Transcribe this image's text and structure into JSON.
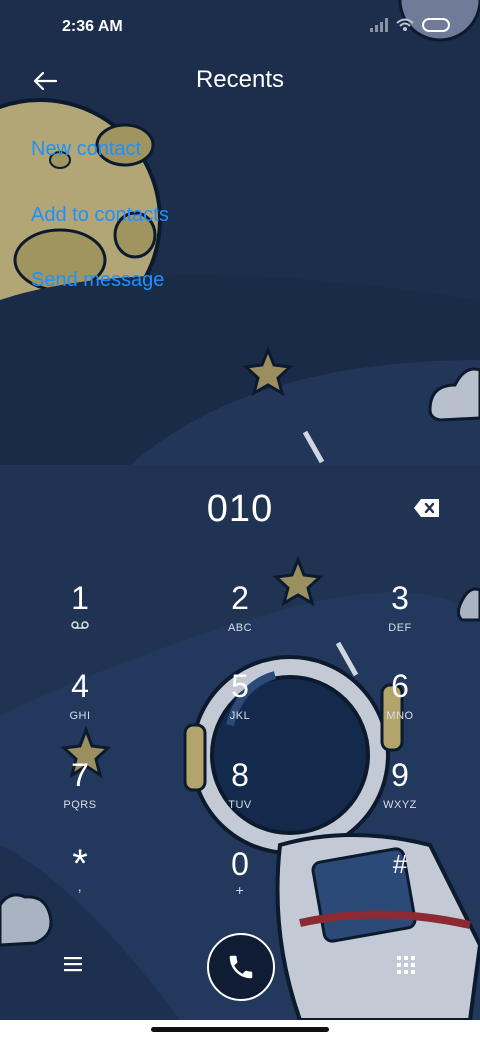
{
  "status_bar": {
    "time": "2:36 AM"
  },
  "header": {
    "title": "Recents"
  },
  "menu": [
    {
      "label": "New contact"
    },
    {
      "label": "Add to contacts"
    },
    {
      "label": "Send message"
    }
  ],
  "dialer": {
    "number": "010"
  },
  "keypad": [
    {
      "digit": "1",
      "letters": ""
    },
    {
      "digit": "2",
      "letters": "ABC"
    },
    {
      "digit": "3",
      "letters": "DEF"
    },
    {
      "digit": "4",
      "letters": "GHI"
    },
    {
      "digit": "5",
      "letters": "JKL"
    },
    {
      "digit": "6",
      "letters": "MNO"
    },
    {
      "digit": "7",
      "letters": "PQRS"
    },
    {
      "digit": "8",
      "letters": "TUV"
    },
    {
      "digit": "9",
      "letters": "WXYZ"
    },
    {
      "digit": "*",
      "letters": ","
    },
    {
      "digit": "0",
      "letters": "+"
    },
    {
      "digit": "#",
      "letters": ""
    }
  ],
  "icons": {
    "back": "arrow-left-icon",
    "backspace": "backspace-icon",
    "menu": "hamburger-menu-icon",
    "call": "phone-icon",
    "keypad": "dialpad-grid-icon",
    "voicemail": "voicemail-icon"
  },
  "colors": {
    "link": "#1e90ff",
    "background_top": "#1c2e4b",
    "background_bottom": "#203352"
  }
}
